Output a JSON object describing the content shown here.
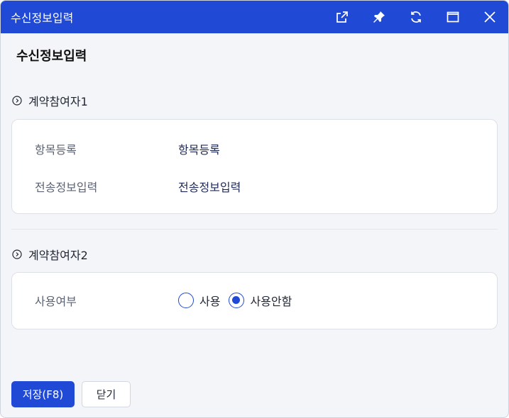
{
  "window": {
    "title": "수신정보입력",
    "icons": [
      "external-link-icon",
      "pin-icon",
      "refresh-icon",
      "maximize-icon",
      "close-icon"
    ]
  },
  "page": {
    "title": "수신정보입력"
  },
  "section1": {
    "title": "계약참여자1",
    "rows": [
      {
        "label": "항목등록",
        "value": "항목등록"
      },
      {
        "label": "전송정보입력",
        "value": "전송정보입력"
      }
    ]
  },
  "section2": {
    "title": "계약참여자2",
    "usage": {
      "label": "사용여부",
      "options": [
        "사용",
        "사용안함"
      ],
      "selected": "사용안함"
    }
  },
  "footer": {
    "save_label": "저장(F8)",
    "close_label": "닫기"
  },
  "colors": {
    "accent": "#2049d6",
    "background": "#f4f5f8",
    "panel": "#ffffff"
  }
}
